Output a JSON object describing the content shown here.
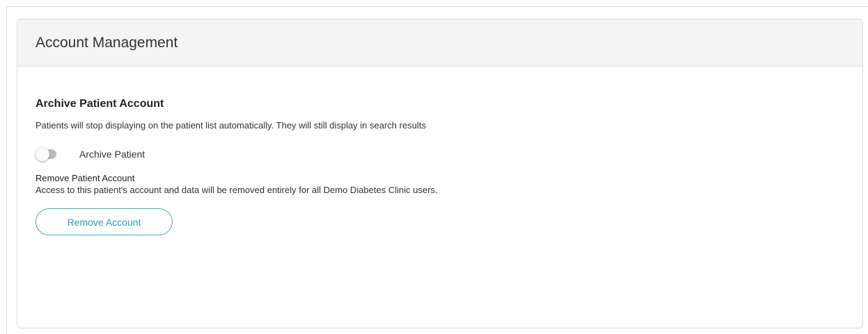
{
  "card": {
    "title": "Account Management"
  },
  "archive": {
    "title": "Archive Patient Account",
    "description": "Patients will stop displaying on the patient list automatically. They will still display in search results",
    "toggle_label": "Archive Patient",
    "toggle_state": "off"
  },
  "remove": {
    "title": "Remove Patient Account",
    "description": "Access to this patient's account and data will be removed entirely for all Demo Diabetes Clinic users.",
    "button_label": "Remove Account"
  },
  "colors": {
    "accent": "#2a9bc8",
    "header_bg": "#f4f4f4",
    "toggle_off": "#bdbdbd"
  }
}
